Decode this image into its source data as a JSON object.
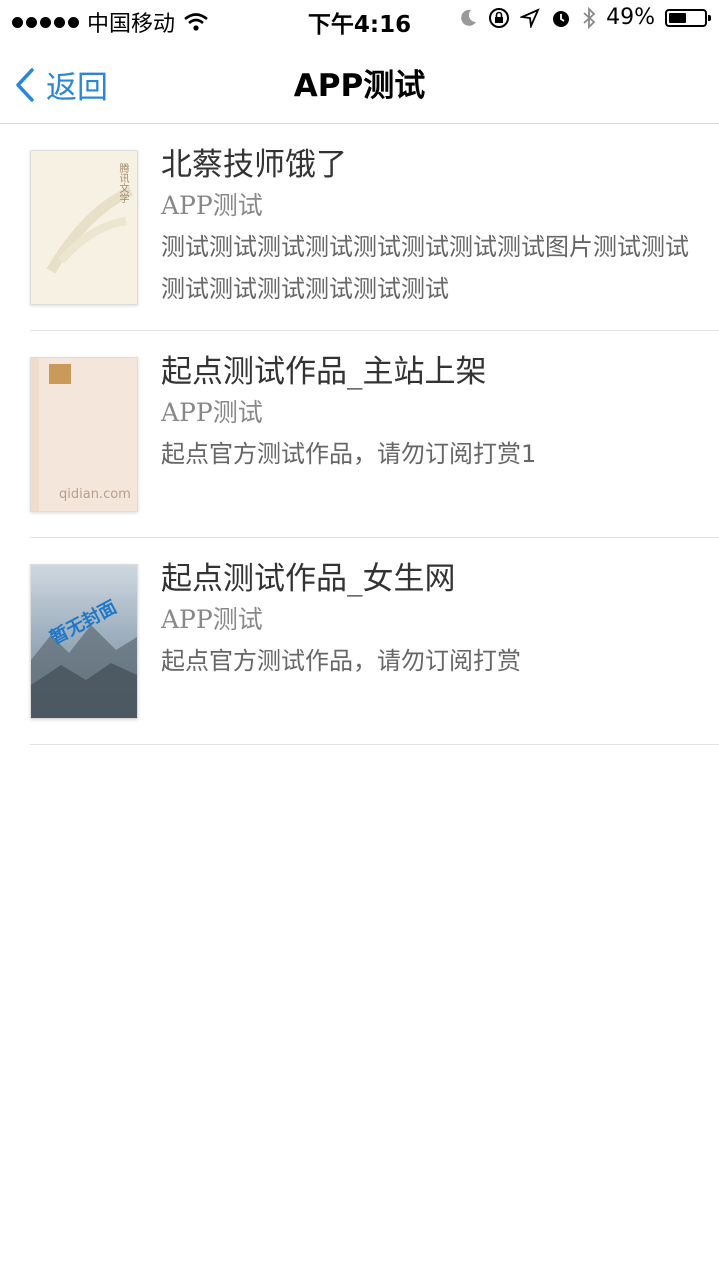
{
  "status_bar": {
    "carrier": "中国移动",
    "time": "下午4:16",
    "battery": "49%",
    "battery_level": 0.49
  },
  "nav": {
    "back_label": "返回",
    "title": "APP测试"
  },
  "books": [
    {
      "title": "北蔡技师饿了",
      "author": "APP测试",
      "desc": "测试测试测试测试测试测试测试测试图片测试测试测试测试测试测试测试测试",
      "cover_text": "腾讯文学"
    },
    {
      "title": "起点测试作品_主站上架",
      "author": "APP测试",
      "desc": "起点官方测试作品，请勿订阅打赏1",
      "cover_text": "qidian.com"
    },
    {
      "title": "起点测试作品_女生网",
      "author": "APP测试",
      "desc": "起点官方测试作品，请勿订阅打赏",
      "cover_text": "暂无封面"
    }
  ]
}
